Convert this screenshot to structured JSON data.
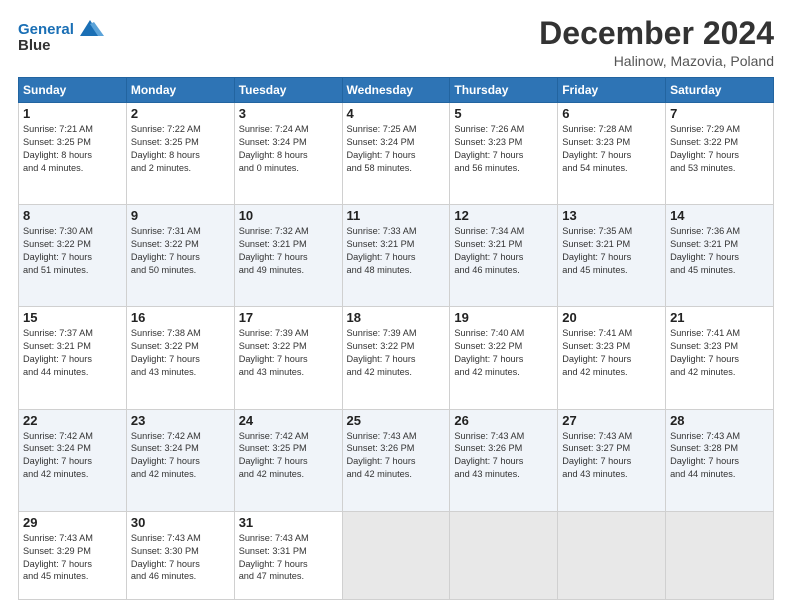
{
  "logo": {
    "line1": "General",
    "line2": "Blue"
  },
  "title": "December 2024",
  "subtitle": "Halinow, Mazovia, Poland",
  "header_days": [
    "Sunday",
    "Monday",
    "Tuesday",
    "Wednesday",
    "Thursday",
    "Friday",
    "Saturday"
  ],
  "weeks": [
    [
      {
        "day": "1",
        "info": "Sunrise: 7:21 AM\nSunset: 3:25 PM\nDaylight: 8 hours\nand 4 minutes."
      },
      {
        "day": "2",
        "info": "Sunrise: 7:22 AM\nSunset: 3:25 PM\nDaylight: 8 hours\nand 2 minutes."
      },
      {
        "day": "3",
        "info": "Sunrise: 7:24 AM\nSunset: 3:24 PM\nDaylight: 8 hours\nand 0 minutes."
      },
      {
        "day": "4",
        "info": "Sunrise: 7:25 AM\nSunset: 3:24 PM\nDaylight: 7 hours\nand 58 minutes."
      },
      {
        "day": "5",
        "info": "Sunrise: 7:26 AM\nSunset: 3:23 PM\nDaylight: 7 hours\nand 56 minutes."
      },
      {
        "day": "6",
        "info": "Sunrise: 7:28 AM\nSunset: 3:23 PM\nDaylight: 7 hours\nand 54 minutes."
      },
      {
        "day": "7",
        "info": "Sunrise: 7:29 AM\nSunset: 3:22 PM\nDaylight: 7 hours\nand 53 minutes."
      }
    ],
    [
      {
        "day": "8",
        "info": "Sunrise: 7:30 AM\nSunset: 3:22 PM\nDaylight: 7 hours\nand 51 minutes."
      },
      {
        "day": "9",
        "info": "Sunrise: 7:31 AM\nSunset: 3:22 PM\nDaylight: 7 hours\nand 50 minutes."
      },
      {
        "day": "10",
        "info": "Sunrise: 7:32 AM\nSunset: 3:21 PM\nDaylight: 7 hours\nand 49 minutes."
      },
      {
        "day": "11",
        "info": "Sunrise: 7:33 AM\nSunset: 3:21 PM\nDaylight: 7 hours\nand 48 minutes."
      },
      {
        "day": "12",
        "info": "Sunrise: 7:34 AM\nSunset: 3:21 PM\nDaylight: 7 hours\nand 46 minutes."
      },
      {
        "day": "13",
        "info": "Sunrise: 7:35 AM\nSunset: 3:21 PM\nDaylight: 7 hours\nand 45 minutes."
      },
      {
        "day": "14",
        "info": "Sunrise: 7:36 AM\nSunset: 3:21 PM\nDaylight: 7 hours\nand 45 minutes."
      }
    ],
    [
      {
        "day": "15",
        "info": "Sunrise: 7:37 AM\nSunset: 3:21 PM\nDaylight: 7 hours\nand 44 minutes."
      },
      {
        "day": "16",
        "info": "Sunrise: 7:38 AM\nSunset: 3:22 PM\nDaylight: 7 hours\nand 43 minutes."
      },
      {
        "day": "17",
        "info": "Sunrise: 7:39 AM\nSunset: 3:22 PM\nDaylight: 7 hours\nand 43 minutes."
      },
      {
        "day": "18",
        "info": "Sunrise: 7:39 AM\nSunset: 3:22 PM\nDaylight: 7 hours\nand 42 minutes."
      },
      {
        "day": "19",
        "info": "Sunrise: 7:40 AM\nSunset: 3:22 PM\nDaylight: 7 hours\nand 42 minutes."
      },
      {
        "day": "20",
        "info": "Sunrise: 7:41 AM\nSunset: 3:23 PM\nDaylight: 7 hours\nand 42 minutes."
      },
      {
        "day": "21",
        "info": "Sunrise: 7:41 AM\nSunset: 3:23 PM\nDaylight: 7 hours\nand 42 minutes."
      }
    ],
    [
      {
        "day": "22",
        "info": "Sunrise: 7:42 AM\nSunset: 3:24 PM\nDaylight: 7 hours\nand 42 minutes."
      },
      {
        "day": "23",
        "info": "Sunrise: 7:42 AM\nSunset: 3:24 PM\nDaylight: 7 hours\nand 42 minutes."
      },
      {
        "day": "24",
        "info": "Sunrise: 7:42 AM\nSunset: 3:25 PM\nDaylight: 7 hours\nand 42 minutes."
      },
      {
        "day": "25",
        "info": "Sunrise: 7:43 AM\nSunset: 3:26 PM\nDaylight: 7 hours\nand 42 minutes."
      },
      {
        "day": "26",
        "info": "Sunrise: 7:43 AM\nSunset: 3:26 PM\nDaylight: 7 hours\nand 43 minutes."
      },
      {
        "day": "27",
        "info": "Sunrise: 7:43 AM\nSunset: 3:27 PM\nDaylight: 7 hours\nand 43 minutes."
      },
      {
        "day": "28",
        "info": "Sunrise: 7:43 AM\nSunset: 3:28 PM\nDaylight: 7 hours\nand 44 minutes."
      }
    ],
    [
      {
        "day": "29",
        "info": "Sunrise: 7:43 AM\nSunset: 3:29 PM\nDaylight: 7 hours\nand 45 minutes."
      },
      {
        "day": "30",
        "info": "Sunrise: 7:43 AM\nSunset: 3:30 PM\nDaylight: 7 hours\nand 46 minutes."
      },
      {
        "day": "31",
        "info": "Sunrise: 7:43 AM\nSunset: 3:31 PM\nDaylight: 7 hours\nand 47 minutes."
      },
      {
        "day": "",
        "info": ""
      },
      {
        "day": "",
        "info": ""
      },
      {
        "day": "",
        "info": ""
      },
      {
        "day": "",
        "info": ""
      }
    ]
  ]
}
